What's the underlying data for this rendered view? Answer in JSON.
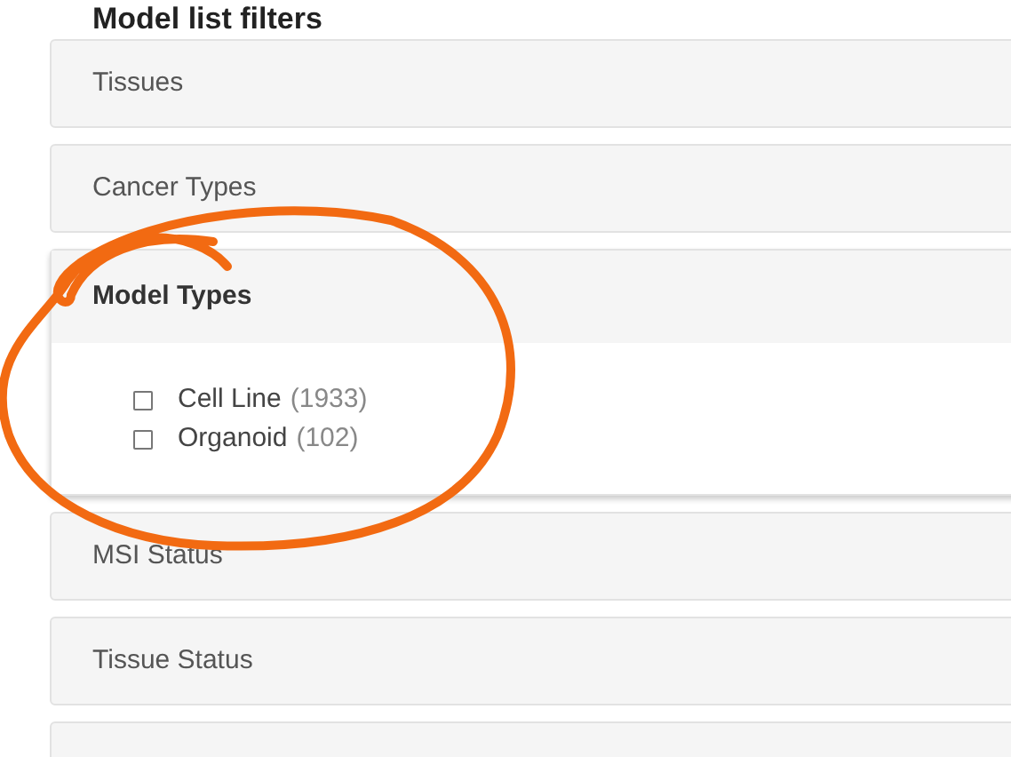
{
  "heading": "Model list filters",
  "panels": [
    {
      "label": "Tissues",
      "expanded": false
    },
    {
      "label": "Cancer Types",
      "expanded": false
    },
    {
      "label": "Model Types",
      "expanded": true,
      "options": [
        {
          "label": "Cell Line",
          "count": "(1933)",
          "checked": false
        },
        {
          "label": "Organoid",
          "count": "(102)",
          "checked": false
        }
      ]
    },
    {
      "label": "MSI Status",
      "expanded": false
    },
    {
      "label": "Tissue Status",
      "expanded": false
    },
    {
      "expanded": false
    }
  ]
}
